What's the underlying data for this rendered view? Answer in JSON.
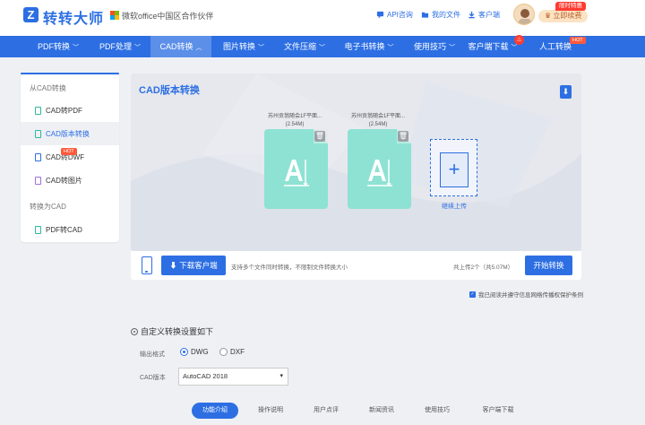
{
  "header": {
    "logo_letter": "Z",
    "brand": "转转大师",
    "partner": "微软office中国区合作伙伴",
    "links": [
      "API咨询",
      "我的文件",
      "客户端"
    ],
    "renew_label": "立即续费",
    "promo_badge": "限时特惠"
  },
  "nav": {
    "items": [
      {
        "label": "PDF转换",
        "chevron": "﹀"
      },
      {
        "label": "PDF处理",
        "chevron": "﹀"
      },
      {
        "label": "CAD转换",
        "chevron": "︿"
      },
      {
        "label": "图片转换",
        "chevron": "﹀"
      },
      {
        "label": "文件压缩",
        "chevron": "﹀"
      },
      {
        "label": "电子书转换",
        "chevron": "﹀"
      },
      {
        "label": "使用技巧",
        "chevron": "﹀"
      },
      {
        "label": "客户端下载",
        "chevron": "﹀"
      },
      {
        "label": "人工转换",
        "chevron": ""
      }
    ],
    "hot_badge": "HOT"
  },
  "sidebar": {
    "section_from": "从CAD转换",
    "items_from": [
      "CAD转PDF",
      "CAD版本转换",
      "CAD转DWF",
      "CAD转图片"
    ],
    "section_to": "转换为CAD",
    "items_to": [
      "PDF转CAD"
    ],
    "hot_badge": "HOT"
  },
  "panel": {
    "title": "CAD版本转换",
    "files": [
      {
        "name": "苏州贡翁随会1F平面...",
        "size": "(2.54M)"
      },
      {
        "name": "苏州贡翁随会1F平面...",
        "size": "(2.54M)"
      }
    ],
    "add_label": "继续上传"
  },
  "actionbar": {
    "download_label": "下载客户端",
    "hint": "支持多个文件同时转换，不限制文件转换大小",
    "summary": "共上传2个（共5.07M）",
    "start_label": "开始转换"
  },
  "agreement": "我已阅读并遵守信息网络传播权保护条例",
  "settings": {
    "title": "自定义转换设置如下",
    "format_label": "输出格式",
    "formats": [
      "DWG",
      "DXF"
    ],
    "selected_format": "DWG",
    "version_label": "CAD版本",
    "version_value": "AutoCAD 2018"
  },
  "bottom_tabs": [
    "功能介绍",
    "操作说明",
    "用户点评",
    "新闻资讯",
    "使用技巧",
    "客户端下载"
  ],
  "colors": {
    "accent": "#2d6fe3",
    "file_card": "#8ee2d3",
    "hot": "#ff5a3c"
  }
}
